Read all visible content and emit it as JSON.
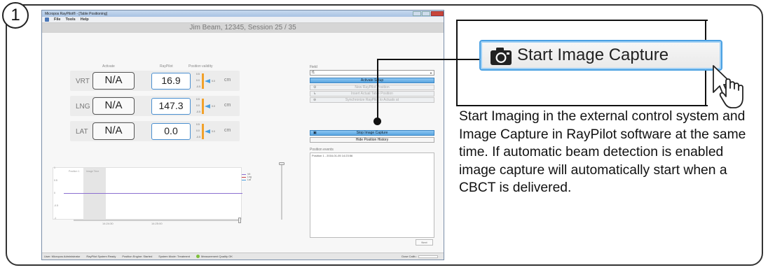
{
  "step": {
    "number": "1"
  },
  "window": {
    "title": "Micropos RayPilot® - [Table Positioning]",
    "menu": [
      "File",
      "Tools",
      "Help"
    ],
    "session": "Jim Beam, 12345, Session 25 / 35"
  },
  "columns": {
    "activate": "Activate",
    "raypilot": "RayPilot",
    "validity": "Position validity"
  },
  "rows": [
    {
      "axis": "VRT",
      "activate": "N/A",
      "value": "16.9",
      "unit": "cm",
      "validity_value": "0.0"
    },
    {
      "axis": "LNG",
      "activate": "N/A",
      "value": "147.3",
      "unit": "cm",
      "validity_value": "0.0"
    },
    {
      "axis": "LAT",
      "activate": "N/A",
      "value": "0.0",
      "unit": "cm",
      "validity_value": "0.0"
    }
  ],
  "validity_ticks": [
    "0.5",
    "0.0",
    "-0.5"
  ],
  "chart": {
    "y_ticks": [
      "1",
      "0.5",
      "0",
      "-0.5",
      "-1"
    ],
    "x_ticks": [
      "14:24:30",
      "14:25:00"
    ],
    "events": [
      "Position 1",
      "Image Time"
    ],
    "legend": [
      "Vrt",
      "Lng",
      "Lat"
    ],
    "legend_colors": [
      "#8b6fd0",
      "#c44",
      "#4a9fe0"
    ]
  },
  "panel": {
    "field_label": "Field",
    "field_value": "f1",
    "activate_setup": "Activate Setup",
    "new_position": "New RayPilot Position",
    "insert_actual": "Insert Actual Table Position",
    "synchronize": "Synchronize RayPilot to Actuals at",
    "stop_capture": "Stop Image Capture",
    "hide_history": "Hide Position History",
    "events_label": "Position events",
    "events": [
      "Position 1 - 2016-01-05 14:23:56"
    ],
    "next": "Next"
  },
  "status": {
    "user": "User: Micropos Administrator",
    "system": "RayPilot System Ready",
    "engine": "Position Engine: Started",
    "mode": "System Mode: Treatment",
    "quality": "Measurement Quality OK",
    "dose": "Dose Calib.:"
  },
  "callout": {
    "button_label": "Start Image Capture",
    "description": "Start Imaging in the external control system and Image Capture in RayPilot software at the same time. If automatic beam detection is enabled image capture will automatically start when a CBCT is delivered."
  }
}
